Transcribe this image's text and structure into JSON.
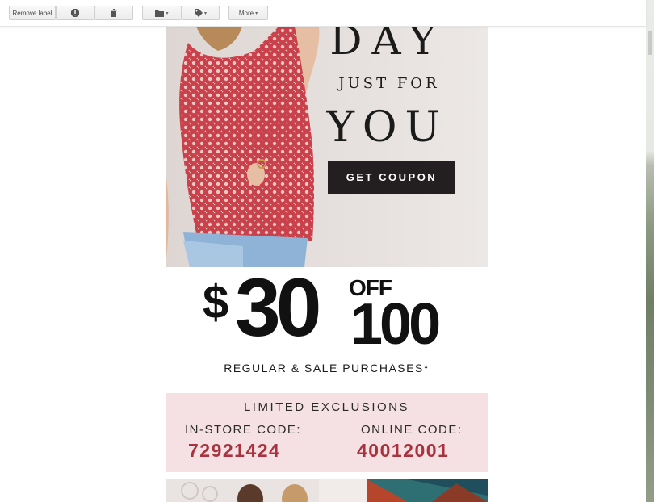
{
  "toolbar": {
    "remove_label": "Remove label",
    "more_label": "More",
    "caret": "▾",
    "icons": [
      "report-spam-icon",
      "delete-icon",
      "move-to-folder-icon",
      "label-tag-icon"
    ]
  },
  "email": {
    "hero": {
      "line1": "DAY",
      "line2": "JUST FOR",
      "line3": "YOU",
      "cta": "GET COUPON"
    },
    "offer": {
      "dollar": "$",
      "amount": "30",
      "off": "OFF",
      "threshold": "100",
      "subtitle": "REGULAR & SALE PURCHASES*"
    },
    "codes": {
      "heading": "LIMITED EXCLUSIONS",
      "instore_label": "IN-STORE CODE:",
      "instore_code": "72921424",
      "online_label": "ONLINE CODE:",
      "online_code": "40012001"
    }
  },
  "colors": {
    "accent_code": "#a8333e",
    "button_dark": "#231f20",
    "codes_background": "#f5e1e3",
    "hero_background": "#ebe6e3",
    "top_pattern": "#c8414b"
  }
}
